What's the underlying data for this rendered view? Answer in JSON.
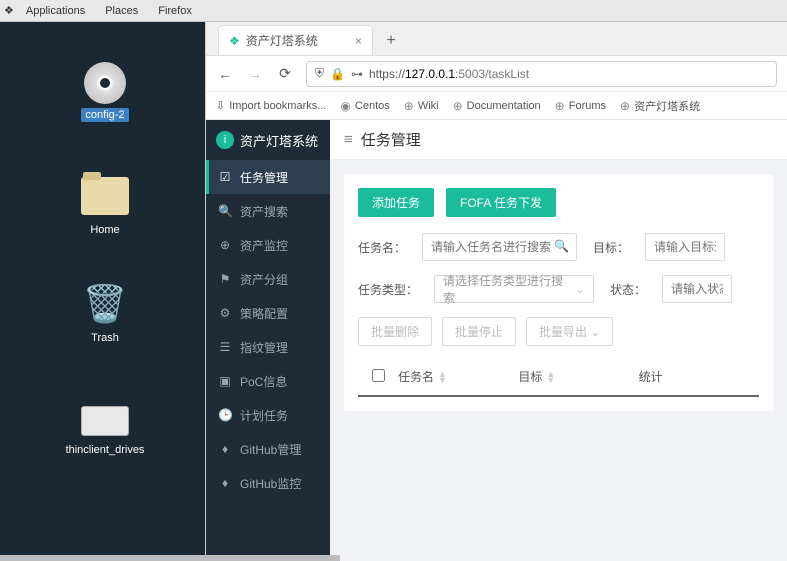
{
  "os": {
    "menus": [
      "Applications",
      "Places",
      "Firefox"
    ]
  },
  "desktop": {
    "icons": [
      {
        "label": "config-2",
        "type": "cd"
      },
      {
        "label": "Home",
        "type": "folder"
      },
      {
        "label": "Trash",
        "type": "trash"
      },
      {
        "label": "thinclient_drives",
        "type": "drive"
      }
    ]
  },
  "browser": {
    "tab_title": "资产灯塔系统",
    "url_prefix": "https://",
    "url_host": "127.0.0.1",
    "url_port_path": ":5003/taskList",
    "bookmarks": [
      "Import bookmarks...",
      "Centos",
      "Wiki",
      "Documentation",
      "Forums",
      "资产灯塔系统"
    ]
  },
  "app": {
    "brand": "资产灯塔系统",
    "sidebar": [
      {
        "label": "任务管理",
        "icon": "☑"
      },
      {
        "label": "资产搜索",
        "icon": "🔍"
      },
      {
        "label": "资产监控",
        "icon": "⊕"
      },
      {
        "label": "资产分组",
        "icon": "⚑"
      },
      {
        "label": "策略配置",
        "icon": "⚙"
      },
      {
        "label": "指纹管理",
        "icon": "☰"
      },
      {
        "label": "PoC信息",
        "icon": "▣"
      },
      {
        "label": "计划任务",
        "icon": "🕒"
      },
      {
        "label": "GitHub管理",
        "icon": "♦"
      },
      {
        "label": "GitHub监控",
        "icon": "♦"
      }
    ],
    "header_title": "任务管理",
    "buttons": {
      "add": "添加任务",
      "fofa": "FOFA 任务下发"
    },
    "filters": {
      "name_label": "任务名：",
      "name_ph": "请输入任务名进行搜索",
      "target_label": "目标：",
      "target_ph": "请输入目标进",
      "type_label": "任务类型：",
      "type_ph": "请选择任务类型进行搜索",
      "status_label": "状态：",
      "status_ph": "请输入状态"
    },
    "batch": {
      "delete": "批量删除",
      "stop": "批量停止",
      "export": "批量导出"
    },
    "table": {
      "col1": "任务名",
      "col2": "目标",
      "col3": "统计"
    }
  }
}
